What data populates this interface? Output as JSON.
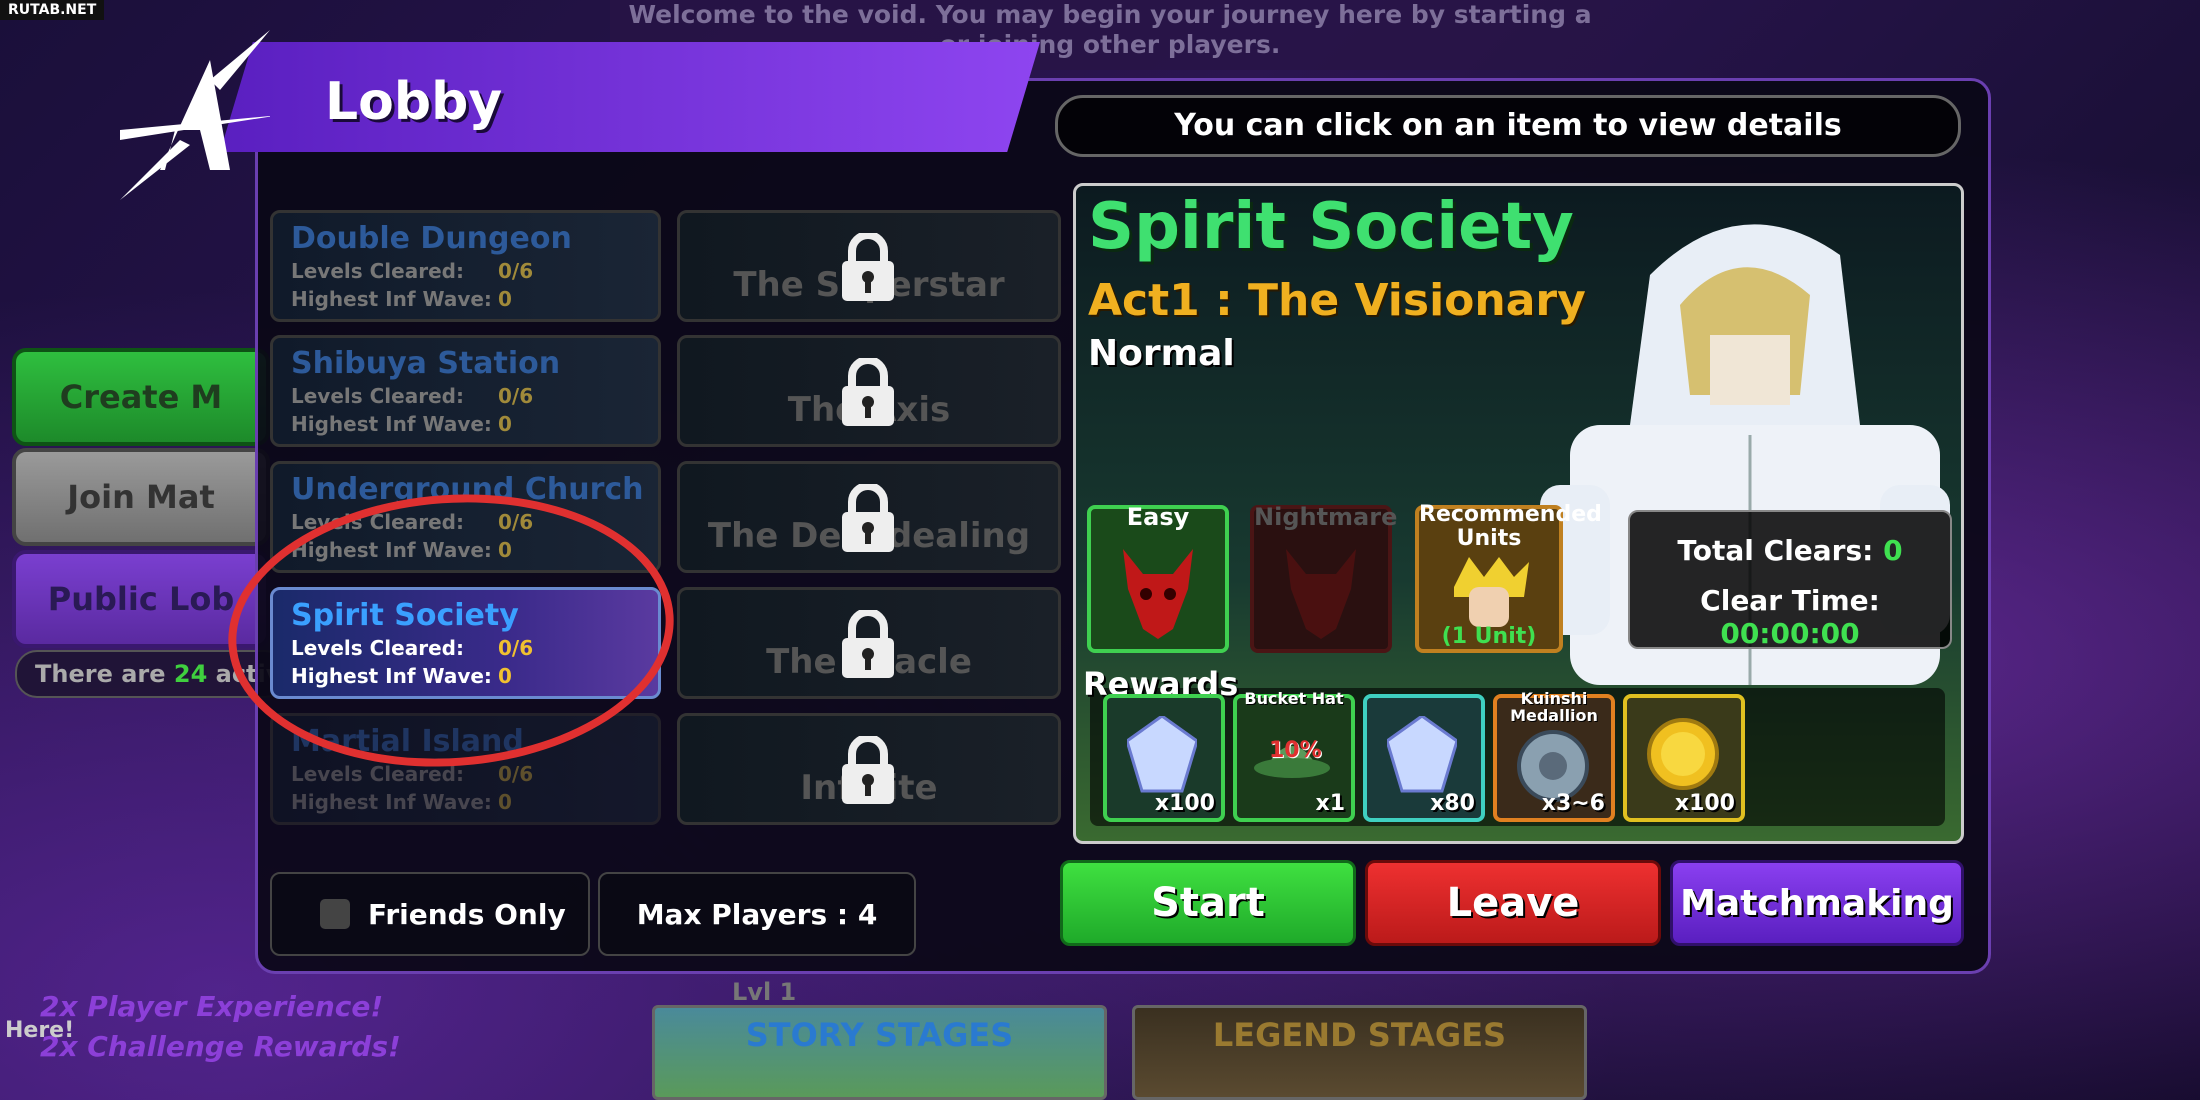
{
  "watermark": "RUTAB.NET",
  "welcome": {
    "line1": "Welcome to the void. You may begin your journey here by starting a",
    "line2": "or joining other players."
  },
  "side": {
    "create": "Create M",
    "join": "Join Mat",
    "public": "Public Lob",
    "active_prefix": "There are ",
    "active_count": "24",
    "active_suffix": " activ"
  },
  "promo": {
    "line1": "2x Player Experience!",
    "line2": "2x Challenge Rewards!",
    "hero": "Here!"
  },
  "header": {
    "title": "Lobby",
    "hint": "You can click on an item to view details"
  },
  "stages": [
    {
      "name": "Double Dungeon",
      "levels_label": "Levels Cleared:",
      "levels": "0/6",
      "wave_label": "Highest Inf Wave:",
      "wave": "0"
    },
    {
      "name": "Shibuya Station",
      "levels_label": "Levels Cleared:",
      "levels": "0/6",
      "wave_label": "Highest Inf Wave:",
      "wave": "0"
    },
    {
      "name": "Underground Church",
      "levels_label": "Levels Cleared:",
      "levels": "0/6",
      "wave_label": "Highest Inf Wave:",
      "wave": "0"
    },
    {
      "name": "Spirit Society",
      "levels_label": "Levels Cleared:",
      "levels": "0/6",
      "wave_label": "Highest Inf Wave:",
      "wave": "0"
    },
    {
      "name": "Martial Island",
      "levels_label": "Levels Cleared:",
      "levels": "0/6",
      "wave_label": "Highest Inf Wave:",
      "wave": "0"
    }
  ],
  "acts": [
    {
      "title": "The Superstar"
    },
    {
      "title": "The Axis"
    },
    {
      "title": "The Deal dealing"
    },
    {
      "title": "The Oracle"
    },
    {
      "title": "Infinite"
    }
  ],
  "options": {
    "friends_only": "Friends Only",
    "max_players": "Max Players : 4"
  },
  "detail": {
    "title": "Spirit Society",
    "act": "Act1 : The Visionary",
    "difficulty": "Normal",
    "easy": "Easy",
    "nightmare": "Nightmare",
    "recommended": "Recommended Units",
    "units": "(1 Unit)",
    "total_clears_label": "Total Clears: ",
    "total_clears": "0",
    "clear_time_label": "Clear Time: ",
    "clear_time": "00:00:00",
    "rewards_label": "Rewards"
  },
  "rewards": [
    {
      "caption": "",
      "qty": "x100",
      "color": "#3fd050"
    },
    {
      "caption": "Bucket Hat",
      "badge": "10%",
      "qty": "x1",
      "color": "#3fd050"
    },
    {
      "caption": "",
      "qty": "x80",
      "color": "#3fd0c0"
    },
    {
      "caption": "Kuinshi Medallion",
      "qty": "x3~6",
      "color": "#e08020"
    },
    {
      "caption": "",
      "qty": "x100",
      "color": "#e0c020"
    }
  ],
  "buttons": {
    "start": "Start",
    "leave": "Leave",
    "matchmaking": "Matchmaking"
  },
  "bottom": {
    "level": "Lvl 1",
    "story": "STORY STAGES",
    "legend": "LEGEND STAGES"
  }
}
